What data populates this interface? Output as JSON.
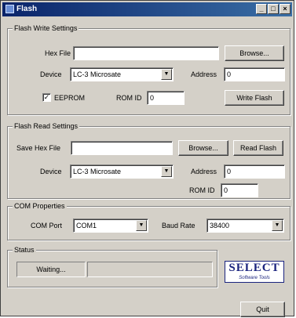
{
  "window": {
    "title": "Flash"
  },
  "write_group": {
    "title": "Flash Write Settings",
    "hex_file_label": "Hex File",
    "hex_file_value": "",
    "browse_label": "Browse...",
    "device_label": "Device",
    "device_value": "LC-3 Microsate",
    "address_label": "Address",
    "address_value": "0",
    "eeprom_label": "EEPROM",
    "eeprom_checked": "✓",
    "rom_id_label": "ROM ID",
    "rom_id_value": "0",
    "write_button": "Write Flash"
  },
  "read_group": {
    "title": "Flash Read Settings",
    "save_hex_label": "Save Hex File",
    "save_hex_value": "",
    "browse_label": "Browse...",
    "read_button": "Read Flash",
    "device_label": "Device",
    "device_value": "LC-3 Microsate",
    "address_label": "Address",
    "address_value": "0",
    "rom_id_label": "ROM ID",
    "rom_id_value": "0"
  },
  "com_group": {
    "title": "COM Properties",
    "port_label": "COM Port",
    "port_value": "COM1",
    "baud_label": "Baud Rate",
    "baud_value": "38400"
  },
  "status_group": {
    "title": "Status",
    "status_text": "Waiting..."
  },
  "logo": {
    "main": "SELECT",
    "sub": "Software Tools"
  },
  "quit_button": "Quit",
  "colors": {
    "title_bar": "#0a246a",
    "logo": "#1a237e",
    "face": "#d4d0c8"
  }
}
